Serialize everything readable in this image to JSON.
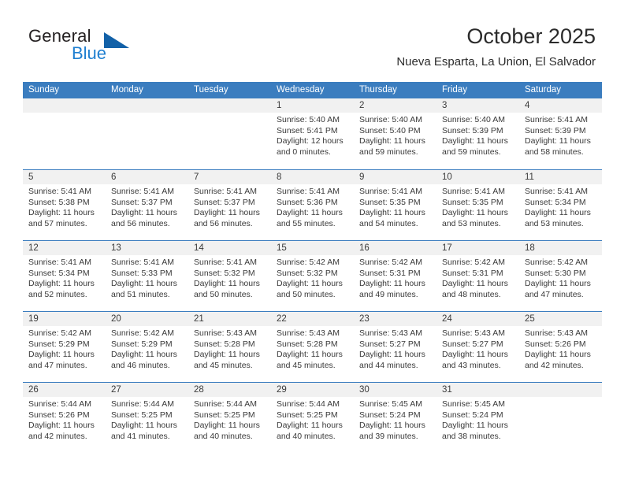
{
  "brand": {
    "name_part1": "General",
    "name_part2": "Blue",
    "triangle_icon": "triangle-icon"
  },
  "header": {
    "title": "October 2025",
    "subtitle": "Nueva Esparta, La Union, El Salvador"
  },
  "colors": {
    "header_blue": "#3b7dbf",
    "band_gray": "#f1f1f1",
    "logo_blue": "#1f7fd0",
    "logo_triangle": "#1261a8",
    "text": "#3a3a3a"
  },
  "calendar": {
    "weekdays": [
      "Sunday",
      "Monday",
      "Tuesday",
      "Wednesday",
      "Thursday",
      "Friday",
      "Saturday"
    ],
    "weeks": [
      [
        {
          "day": "",
          "empty": true
        },
        {
          "day": "",
          "empty": true
        },
        {
          "day": "",
          "empty": true
        },
        {
          "day": "1",
          "sunrise": "Sunrise: 5:40 AM",
          "sunset": "Sunset: 5:41 PM",
          "daylight1": "Daylight: 12 hours",
          "daylight2": "and 0 minutes."
        },
        {
          "day": "2",
          "sunrise": "Sunrise: 5:40 AM",
          "sunset": "Sunset: 5:40 PM",
          "daylight1": "Daylight: 11 hours",
          "daylight2": "and 59 minutes."
        },
        {
          "day": "3",
          "sunrise": "Sunrise: 5:40 AM",
          "sunset": "Sunset: 5:39 PM",
          "daylight1": "Daylight: 11 hours",
          "daylight2": "and 59 minutes."
        },
        {
          "day": "4",
          "sunrise": "Sunrise: 5:41 AM",
          "sunset": "Sunset: 5:39 PM",
          "daylight1": "Daylight: 11 hours",
          "daylight2": "and 58 minutes."
        }
      ],
      [
        {
          "day": "5",
          "sunrise": "Sunrise: 5:41 AM",
          "sunset": "Sunset: 5:38 PM",
          "daylight1": "Daylight: 11 hours",
          "daylight2": "and 57 minutes."
        },
        {
          "day": "6",
          "sunrise": "Sunrise: 5:41 AM",
          "sunset": "Sunset: 5:37 PM",
          "daylight1": "Daylight: 11 hours",
          "daylight2": "and 56 minutes."
        },
        {
          "day": "7",
          "sunrise": "Sunrise: 5:41 AM",
          "sunset": "Sunset: 5:37 PM",
          "daylight1": "Daylight: 11 hours",
          "daylight2": "and 56 minutes."
        },
        {
          "day": "8",
          "sunrise": "Sunrise: 5:41 AM",
          "sunset": "Sunset: 5:36 PM",
          "daylight1": "Daylight: 11 hours",
          "daylight2": "and 55 minutes."
        },
        {
          "day": "9",
          "sunrise": "Sunrise: 5:41 AM",
          "sunset": "Sunset: 5:35 PM",
          "daylight1": "Daylight: 11 hours",
          "daylight2": "and 54 minutes."
        },
        {
          "day": "10",
          "sunrise": "Sunrise: 5:41 AM",
          "sunset": "Sunset: 5:35 PM",
          "daylight1": "Daylight: 11 hours",
          "daylight2": "and 53 minutes."
        },
        {
          "day": "11",
          "sunrise": "Sunrise: 5:41 AM",
          "sunset": "Sunset: 5:34 PM",
          "daylight1": "Daylight: 11 hours",
          "daylight2": "and 53 minutes."
        }
      ],
      [
        {
          "day": "12",
          "sunrise": "Sunrise: 5:41 AM",
          "sunset": "Sunset: 5:34 PM",
          "daylight1": "Daylight: 11 hours",
          "daylight2": "and 52 minutes."
        },
        {
          "day": "13",
          "sunrise": "Sunrise: 5:41 AM",
          "sunset": "Sunset: 5:33 PM",
          "daylight1": "Daylight: 11 hours",
          "daylight2": "and 51 minutes."
        },
        {
          "day": "14",
          "sunrise": "Sunrise: 5:41 AM",
          "sunset": "Sunset: 5:32 PM",
          "daylight1": "Daylight: 11 hours",
          "daylight2": "and 50 minutes."
        },
        {
          "day": "15",
          "sunrise": "Sunrise: 5:42 AM",
          "sunset": "Sunset: 5:32 PM",
          "daylight1": "Daylight: 11 hours",
          "daylight2": "and 50 minutes."
        },
        {
          "day": "16",
          "sunrise": "Sunrise: 5:42 AM",
          "sunset": "Sunset: 5:31 PM",
          "daylight1": "Daylight: 11 hours",
          "daylight2": "and 49 minutes."
        },
        {
          "day": "17",
          "sunrise": "Sunrise: 5:42 AM",
          "sunset": "Sunset: 5:31 PM",
          "daylight1": "Daylight: 11 hours",
          "daylight2": "and 48 minutes."
        },
        {
          "day": "18",
          "sunrise": "Sunrise: 5:42 AM",
          "sunset": "Sunset: 5:30 PM",
          "daylight1": "Daylight: 11 hours",
          "daylight2": "and 47 minutes."
        }
      ],
      [
        {
          "day": "19",
          "sunrise": "Sunrise: 5:42 AM",
          "sunset": "Sunset: 5:29 PM",
          "daylight1": "Daylight: 11 hours",
          "daylight2": "and 47 minutes."
        },
        {
          "day": "20",
          "sunrise": "Sunrise: 5:42 AM",
          "sunset": "Sunset: 5:29 PM",
          "daylight1": "Daylight: 11 hours",
          "daylight2": "and 46 minutes."
        },
        {
          "day": "21",
          "sunrise": "Sunrise: 5:43 AM",
          "sunset": "Sunset: 5:28 PM",
          "daylight1": "Daylight: 11 hours",
          "daylight2": "and 45 minutes."
        },
        {
          "day": "22",
          "sunrise": "Sunrise: 5:43 AM",
          "sunset": "Sunset: 5:28 PM",
          "daylight1": "Daylight: 11 hours",
          "daylight2": "and 45 minutes."
        },
        {
          "day": "23",
          "sunrise": "Sunrise: 5:43 AM",
          "sunset": "Sunset: 5:27 PM",
          "daylight1": "Daylight: 11 hours",
          "daylight2": "and 44 minutes."
        },
        {
          "day": "24",
          "sunrise": "Sunrise: 5:43 AM",
          "sunset": "Sunset: 5:27 PM",
          "daylight1": "Daylight: 11 hours",
          "daylight2": "and 43 minutes."
        },
        {
          "day": "25",
          "sunrise": "Sunrise: 5:43 AM",
          "sunset": "Sunset: 5:26 PM",
          "daylight1": "Daylight: 11 hours",
          "daylight2": "and 42 minutes."
        }
      ],
      [
        {
          "day": "26",
          "sunrise": "Sunrise: 5:44 AM",
          "sunset": "Sunset: 5:26 PM",
          "daylight1": "Daylight: 11 hours",
          "daylight2": "and 42 minutes."
        },
        {
          "day": "27",
          "sunrise": "Sunrise: 5:44 AM",
          "sunset": "Sunset: 5:25 PM",
          "daylight1": "Daylight: 11 hours",
          "daylight2": "and 41 minutes."
        },
        {
          "day": "28",
          "sunrise": "Sunrise: 5:44 AM",
          "sunset": "Sunset: 5:25 PM",
          "daylight1": "Daylight: 11 hours",
          "daylight2": "and 40 minutes."
        },
        {
          "day": "29",
          "sunrise": "Sunrise: 5:44 AM",
          "sunset": "Sunset: 5:25 PM",
          "daylight1": "Daylight: 11 hours",
          "daylight2": "and 40 minutes."
        },
        {
          "day": "30",
          "sunrise": "Sunrise: 5:45 AM",
          "sunset": "Sunset: 5:24 PM",
          "daylight1": "Daylight: 11 hours",
          "daylight2": "and 39 minutes."
        },
        {
          "day": "31",
          "sunrise": "Sunrise: 5:45 AM",
          "sunset": "Sunset: 5:24 PM",
          "daylight1": "Daylight: 11 hours",
          "daylight2": "and 38 minutes."
        },
        {
          "day": "",
          "empty": true
        }
      ]
    ]
  }
}
